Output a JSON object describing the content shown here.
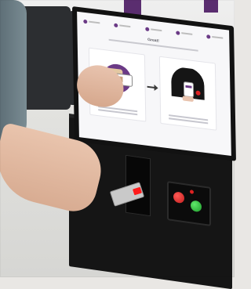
{
  "scene": {
    "colors": {
      "accent_purple": "#5a2d6f",
      "kiosk_black": "#151515",
      "button_red": "#d22",
      "button_green": "#22a52f"
    },
    "screen": {
      "title": "Great!",
      "panels": [
        {
          "icon": "id-card-icon"
        },
        {
          "icon": "card-scanner-icon"
        }
      ]
    }
  }
}
